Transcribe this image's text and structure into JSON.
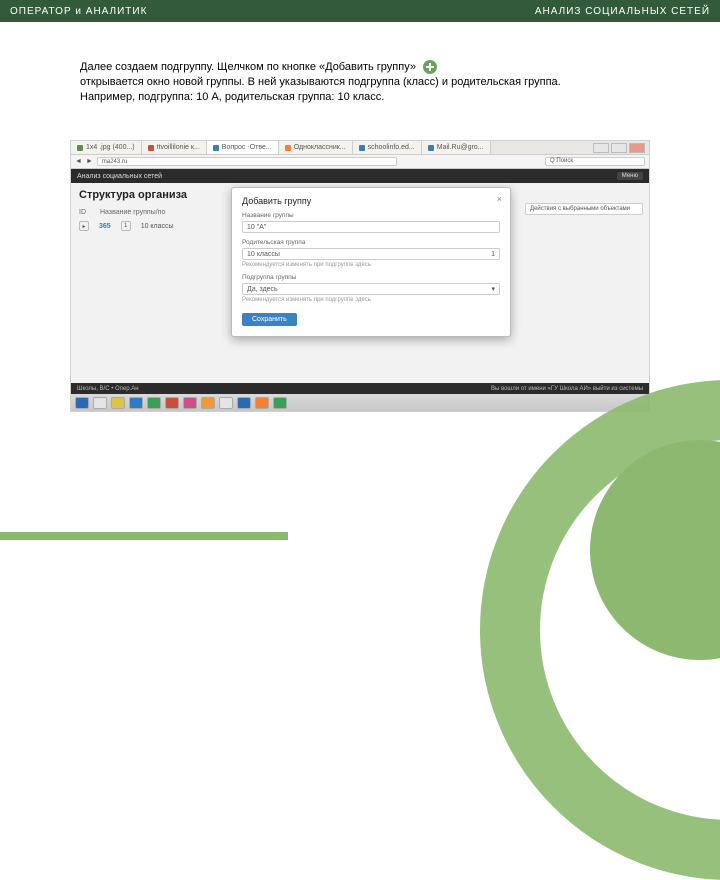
{
  "header": {
    "left": "ОПЕРАТОР и АНАЛИТИК",
    "right": "АНАЛИЗ СОЦИАЛЬНЫХ СЕТЕЙ"
  },
  "paragraph": {
    "line1a": "Далее создаем подгруппу. Щелчком по кнопке «Добавить группу»",
    "line2": "открывается окно новой группы. В ней указываются подгруппа (класс)  и родительская группа.",
    "line3": "Например, подгруппа: 10 А, родительская группа: 10 класс."
  },
  "browser": {
    "tabs": [
      {
        "label": "1x4 .jpg (400...)",
        "favColor": "#5b8d5a"
      },
      {
        "label": "ttvoillilonie к...",
        "favColor": "#c94f3d"
      },
      {
        "label": "Вопрос -Отве...",
        "favColor": "#3a7fb3",
        "active": true
      },
      {
        "label": "Одноклассник...",
        "favColor": "#f57f32"
      },
      {
        "label": "schoolinfo.ed...",
        "favColor": "#3a7fb3"
      },
      {
        "label": "Mail.Ru@gro...",
        "favColor": "#3a7fb3"
      }
    ],
    "url": "ma243.ru",
    "search": "Q Поиск"
  },
  "app": {
    "title_bar": "Анализ социальных сетей",
    "menu_btn": "Меню",
    "page_title": "Структура организа",
    "table": {
      "col_id": "ID",
      "col_name": "Название группы/по",
      "row_id": "365",
      "row_cnt": "1",
      "row_name": "10 классы"
    },
    "actions_label": "Действия с выбранными объектами",
    "footer_left": "Школы, В/С • Опер.Ан",
    "footer_right": "Вы вошли от имени «ГУ Школа АИ» выйти из системы"
  },
  "modal": {
    "title": "Добавить группу",
    "label_name": "Название группы",
    "value_name": "10 \"А\"",
    "label_parent": "Родительская группа",
    "value_parent": "10 классы",
    "counter": "1",
    "label_project": "Подгруппа группы",
    "value_project": "Да, здесь",
    "hint": "Рекомендуется изменять при подгруппе здесь",
    "save": "Сохранить"
  },
  "taskbar": {
    "colors": [
      "#2a6ab5",
      "#e5e5e5",
      "#d9c648",
      "#3279c7",
      "#3aa055",
      "#c94f3d",
      "#cf4e8a",
      "#f19838",
      "#e5e5e5",
      "#2a6ab5",
      "#f57f32",
      "#3aa055"
    ]
  }
}
